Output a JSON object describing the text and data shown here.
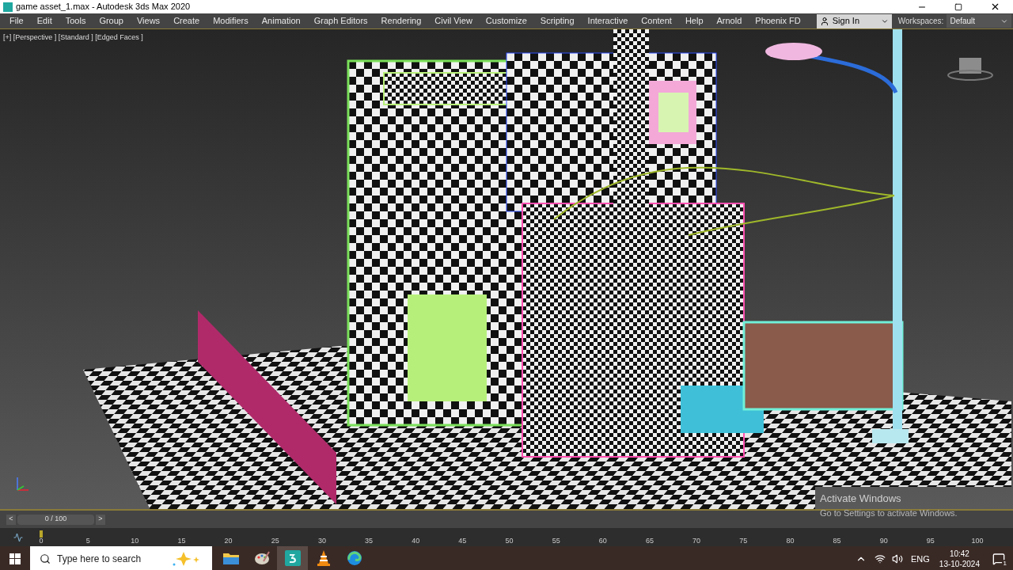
{
  "window": {
    "title": "game asset_1.max - Autodesk 3ds Max 2020"
  },
  "menu": [
    "File",
    "Edit",
    "Tools",
    "Group",
    "Views",
    "Create",
    "Modifiers",
    "Animation",
    "Graph Editors",
    "Rendering",
    "Civil View",
    "Customize",
    "Scripting",
    "Interactive",
    "Content",
    "Help",
    "Arnold",
    "Phoenix FD"
  ],
  "sign_in": {
    "label": "Sign In"
  },
  "workspaces": {
    "label": "Workspaces:",
    "value": "Default"
  },
  "viewport": {
    "label": "[+] [Perspective ] [Standard ] [Edged Faces ]"
  },
  "activation_notice": {
    "title": "Activate Windows",
    "message": "Go to Settings to activate Windows."
  },
  "time_slider": {
    "prev": "<",
    "next": ">",
    "reading": "0 / 100"
  },
  "track_bar": {
    "ticks": [
      "0",
      "5",
      "10",
      "15",
      "20",
      "25",
      "30",
      "35",
      "40",
      "45",
      "50",
      "55",
      "60",
      "65",
      "70",
      "75",
      "80",
      "85",
      "90",
      "95",
      "100"
    ]
  },
  "taskbar": {
    "search": {
      "placeholder": "Type here to search"
    },
    "apps": [
      {
        "kind": "folder",
        "selected": false
      },
      {
        "kind": "paint",
        "selected": false
      },
      {
        "kind": "max",
        "selected": true
      },
      {
        "kind": "cone",
        "selected": false
      },
      {
        "kind": "edge",
        "selected": false
      }
    ],
    "language": "ENG",
    "time": "10:42",
    "date": "13-10-2024",
    "notifications": "1"
  }
}
